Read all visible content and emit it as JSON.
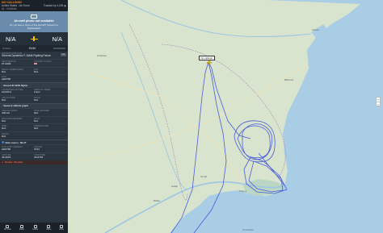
{
  "panel": {
    "callsign": "NO CALLSIGN",
    "operator": "United States - Air Force",
    "tracked_by": "Tracked by 4,249 ◉",
    "flight_number": "#1 · 0/c/bbdc",
    "photo_title": "Aircraft photo not available",
    "photo_sub": "Do you have a photo of this aircraft? Upload it to Flightradar24",
    "origin": "N/A",
    "destination": "N/A",
    "time_left": "01:54",
    "time_left_label": "ACTUAL",
    "time_right_label": "ESTIMATED",
    "aircraft_type_label": "AIRCRAFT TYPE (F16)",
    "aircraft_type": "General Dynamics F-16AM Fighting Falcon",
    "badge": "F16",
    "registration_label": "REGISTRATION",
    "registration": "87-0005",
    "country_label": "COUNTRY OF REG.",
    "serial_label": "SERIAL NUMBER (MSN)",
    "serial": "N/A",
    "age_label": "AGE",
    "icao_label": "ICAO",
    "icao": "AE0798",
    "age": "N/A",
    "sec1": "Record 87-0005 flights",
    "cal_alt_label": "CALIBRATED ALTITUDE",
    "cal_alt": "20,000 ft",
    "vs_label": "VERTICAL SPEED",
    "vs": "0 fpm",
    "gps_alt_label": "GPS ALTITUDE",
    "gps_alt": "N/A",
    "track_label": "TRACK",
    "track": "N/A",
    "sec2": "Speed & altitude graph",
    "gs_label": "GROUND SPEED",
    "gs": "448 kts",
    "tas_label": "TRUE AIRSPEED",
    "tas": "N/A",
    "ias_label": "INDICATED AIRSPEED",
    "ias": "N/A",
    "mach_label": "MACH",
    "mach": "N/A",
    "wind_label": "WIND",
    "wind": "N/A",
    "temp_label": "TEMPERATURE",
    "temp": "N/A",
    "fir_label": "FIR/UIR",
    "fir": "N/A",
    "sec3": "Data source - MLAT",
    "icao2_label": "ICAO 24-BIT ADDRESS",
    "icao2": "AE0798",
    "squawk_label": "SQUAWK",
    "squawk": "3724",
    "lat_label": "LATITUDE",
    "lat": "45.4876",
    "lon_label": "LONGITUDE",
    "lon": "28.9763",
    "alert": "Squawk · Boundary",
    "bottom": [
      "3D View",
      "Route",
      "Follow",
      "Share",
      "More"
    ]
  },
  "map": {
    "callout": "No callsign",
    "cities": [
      "Chișinău",
      "Odesa",
      "Galați",
      "Brăila",
      "Tulcea",
      "Constanța",
      "Izmail",
      "Bilhorod"
    ],
    "track_color": "#3b4fd8"
  }
}
